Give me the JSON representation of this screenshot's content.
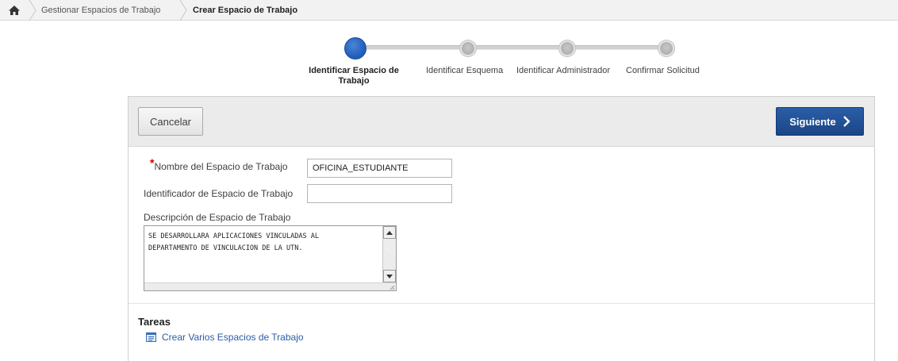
{
  "breadcrumb": {
    "home_icon": "home-icon",
    "link": "Gestionar Espacios de Trabajo",
    "current": "Crear Espacio de Trabajo"
  },
  "wizard": {
    "steps": [
      {
        "label": "Identificar Espacio de",
        "label2": "Trabajo",
        "active": true
      },
      {
        "label": "Identificar Esquema",
        "active": false
      },
      {
        "label": "Identificar Administrador",
        "active": false
      },
      {
        "label": "Confirmar Solicitud",
        "active": false
      }
    ]
  },
  "toolbar": {
    "cancel_label": "Cancelar",
    "next_label": "Siguiente"
  },
  "form": {
    "workspace_name": {
      "label": "Nombre del Espacio de Trabajo",
      "value": "OFICINA_ESTUDIANTE",
      "required": true
    },
    "workspace_id": {
      "label": "Identificador de Espacio de Trabajo",
      "value": ""
    },
    "workspace_desc": {
      "label": "Descripción de Espacio de Trabajo",
      "value": "SE DESARROLLARA APLICACIONES VINCULADAS AL\nDEPARTAMENTO DE VINCULACION DE LA UTN."
    }
  },
  "tasks": {
    "title": "Tareas",
    "items": [
      {
        "label": "Crear Varios Espacios de Trabajo",
        "icon": "list-document-icon"
      }
    ]
  },
  "colors": {
    "accent": "#1f4e96",
    "required": "#cc0000",
    "link": "#2a5da8"
  }
}
